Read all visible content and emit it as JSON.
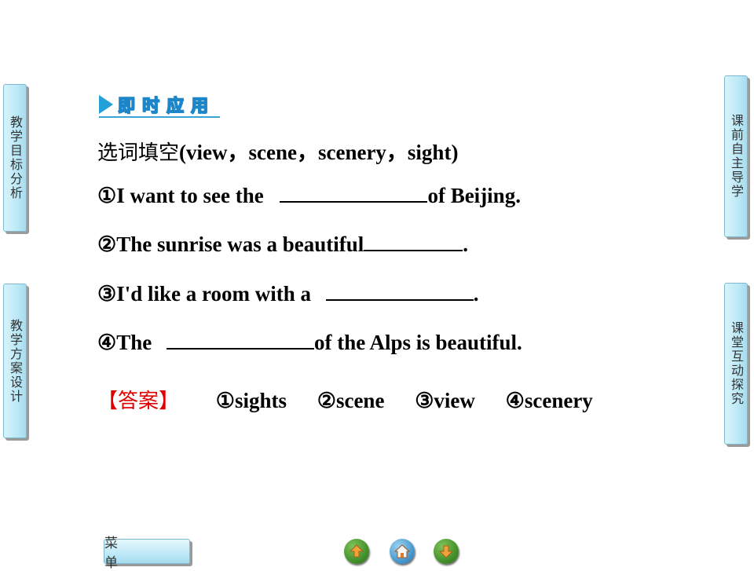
{
  "side_tabs": {
    "left": [
      {
        "label": "教学目标分析"
      },
      {
        "label": "教学方案设计"
      }
    ],
    "right": [
      {
        "label": "课前自主导学"
      },
      {
        "label": "课堂互动探究"
      }
    ]
  },
  "heading": {
    "text": "即时应用",
    "icon": "triangle-arrow-icon"
  },
  "exercise": {
    "instruction_cn": "选词填空",
    "instruction_words": "(view，scene，scenery，sight)",
    "questions": [
      {
        "num": "①",
        "before": "I want to see the ",
        "after": "of Beijing."
      },
      {
        "num": "②",
        "before": "The sunrise was a beautiful",
        "after": "."
      },
      {
        "num": "③",
        "before": "I'd like a room with a ",
        "after": "."
      },
      {
        "num": "④",
        "before": "The ",
        "after": "of the Alps is beautiful."
      }
    ]
  },
  "answer": {
    "label": "【答案】",
    "items": [
      "①sights",
      "②scene",
      "③view",
      "④scenery"
    ]
  },
  "bottom_bar": {
    "menu_label": "菜 单",
    "icons": [
      "prev-arrow-icon",
      "home-icon",
      "next-arrow-icon"
    ]
  },
  "colors": {
    "accent": "#1d86c9",
    "answer_label": "#e00000",
    "tab_bg": "#bfeaf7"
  }
}
